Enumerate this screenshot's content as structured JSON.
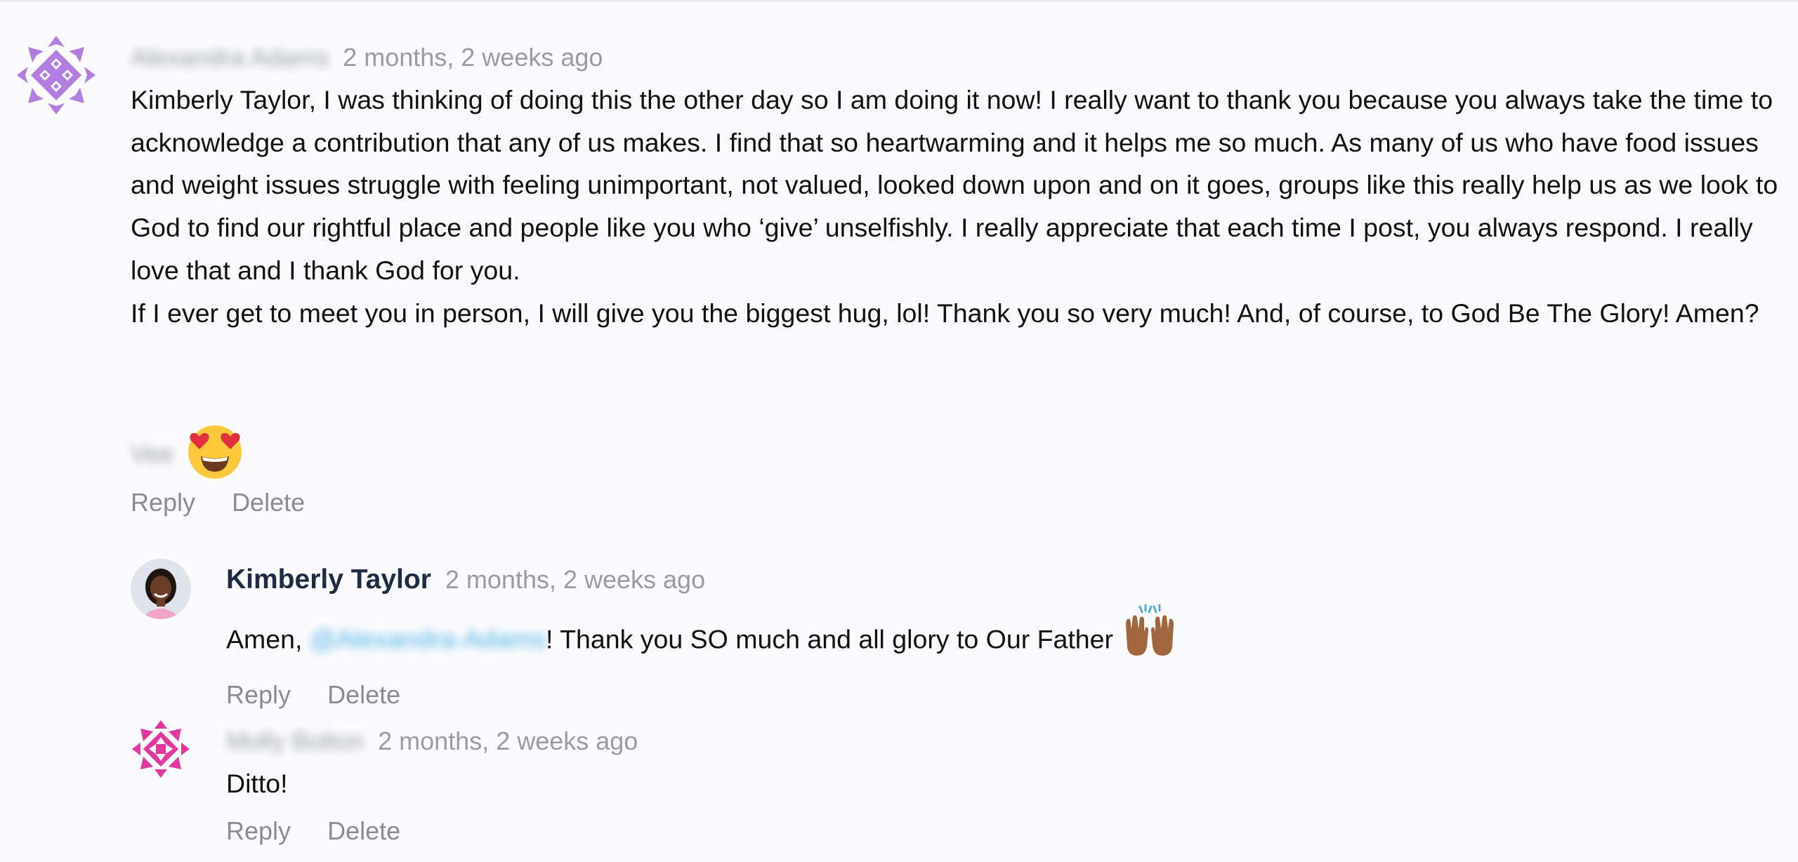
{
  "comments": [
    {
      "author": "Alexandra Adams",
      "time": "2 months, 2 weeks ago",
      "paragraphs": [
        "Kimberly Taylor, I was thinking of doing this the other day so I am doing it now!  I really want to thank you because you always take the time to acknowledge a contribution that any of us makes.  I find that so heartwarming and it helps me so much.  As many of us who have food issues and weight issues struggle with feeling unimportant, not valued, looked down upon and on it goes, groups like this really help us as we look to God to find our rightful place and people like you who ‘give’ unselfishly.  I really appreciate that each time I post, you always respond. I really love that and I thank God for you.",
        "If I ever get to meet you in person, I will give you the biggest hug, lol!  Thank you so very much!  And, of course, to God Be The Glory!  Amen?"
      ],
      "reaction": {
        "user": "Vee",
        "emoji": "heart-eyes-emoji"
      },
      "reply_label": "Reply",
      "delete_label": "Delete"
    },
    {
      "author": "Kimberly Taylor",
      "time": "2 months, 2 weeks ago",
      "text_prefix": "Amen, ",
      "mention": "@Alexandra-Adams",
      "text_suffix": "! Thank you SO much and all glory to Our Father",
      "emoji": "raising-hands-emoji",
      "reply_label": "Reply",
      "delete_label": "Delete"
    },
    {
      "author": "Molly Bolton",
      "time": "2 months, 2 weeks ago",
      "text": "Ditto!",
      "reply_label": "Reply",
      "delete_label": "Delete"
    }
  ],
  "colors": {
    "background": "#fbfbfd",
    "author_name": "#1d2b44",
    "timestamp": "#9a9a9f",
    "action_link": "#8b8b90",
    "mention": "#4db3e6",
    "avatar_purple": "#b17de0",
    "avatar_pink": "#e0389f"
  }
}
